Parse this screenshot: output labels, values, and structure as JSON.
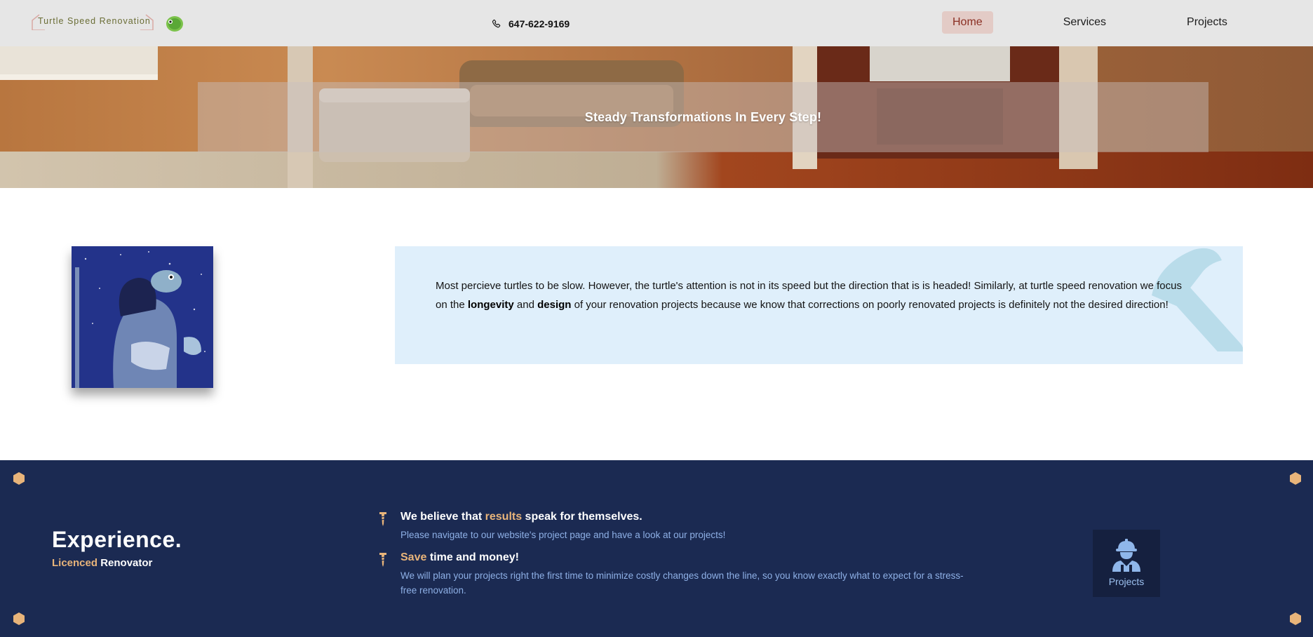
{
  "header": {
    "logo_text": "Turtle Speed Renovation",
    "phone": "647-622-9169",
    "nav": {
      "home": "Home",
      "services": "Services",
      "projects": "Projects"
    },
    "active_nav": "Home"
  },
  "hero": {
    "tagline": "Steady Transformations In Every Step!"
  },
  "about": {
    "text_before_longevity": "Most percieve turtles to be slow. However, the turtle's attention is not in its speed but the direction that is is headed! Similarly, at turtle speed renovation we focus on the ",
    "bold_longevity": "longevity",
    "text_and": " and ",
    "bold_design": "design",
    "text_after_design": " of your renovation projects because we know that corrections on poorly renovated projects is definitely not the desired direction!"
  },
  "experience": {
    "title": "Experience.",
    "subtitle_accent": "Licenced",
    "subtitle_rest": " Renovator",
    "points": [
      {
        "title_pre": "We believe that ",
        "title_accent": "results",
        "title_post": " speak for themselves.",
        "text": "Please navigate to our website's project page and have a look at our projects!"
      },
      {
        "title_pre": "",
        "title_accent": "Save",
        "title_post": " time and money!",
        "text": "We will plan your projects right the first time to minimize costly changes down the line, so you know exactly what to expect for a stress-free renovation."
      }
    ],
    "projects_tile_label": "Projects"
  },
  "colors": {
    "header_bg": "#e6e6e6",
    "nav_active_bg": "#e3cbc6",
    "nav_active_text": "#8a2e22",
    "about_card_bg": "#dfeffb",
    "experience_bg": "#1b2a52",
    "accent": "#e8b47a",
    "body_link_blue": "#8eb0e6"
  },
  "icons": {
    "phone": "phone-icon",
    "logo_mascot": "turtle-icon",
    "hammer": "hammer-icon",
    "screw": "screw-icon",
    "hex": "hex-bolt-icon",
    "worker": "construction-worker-icon"
  }
}
